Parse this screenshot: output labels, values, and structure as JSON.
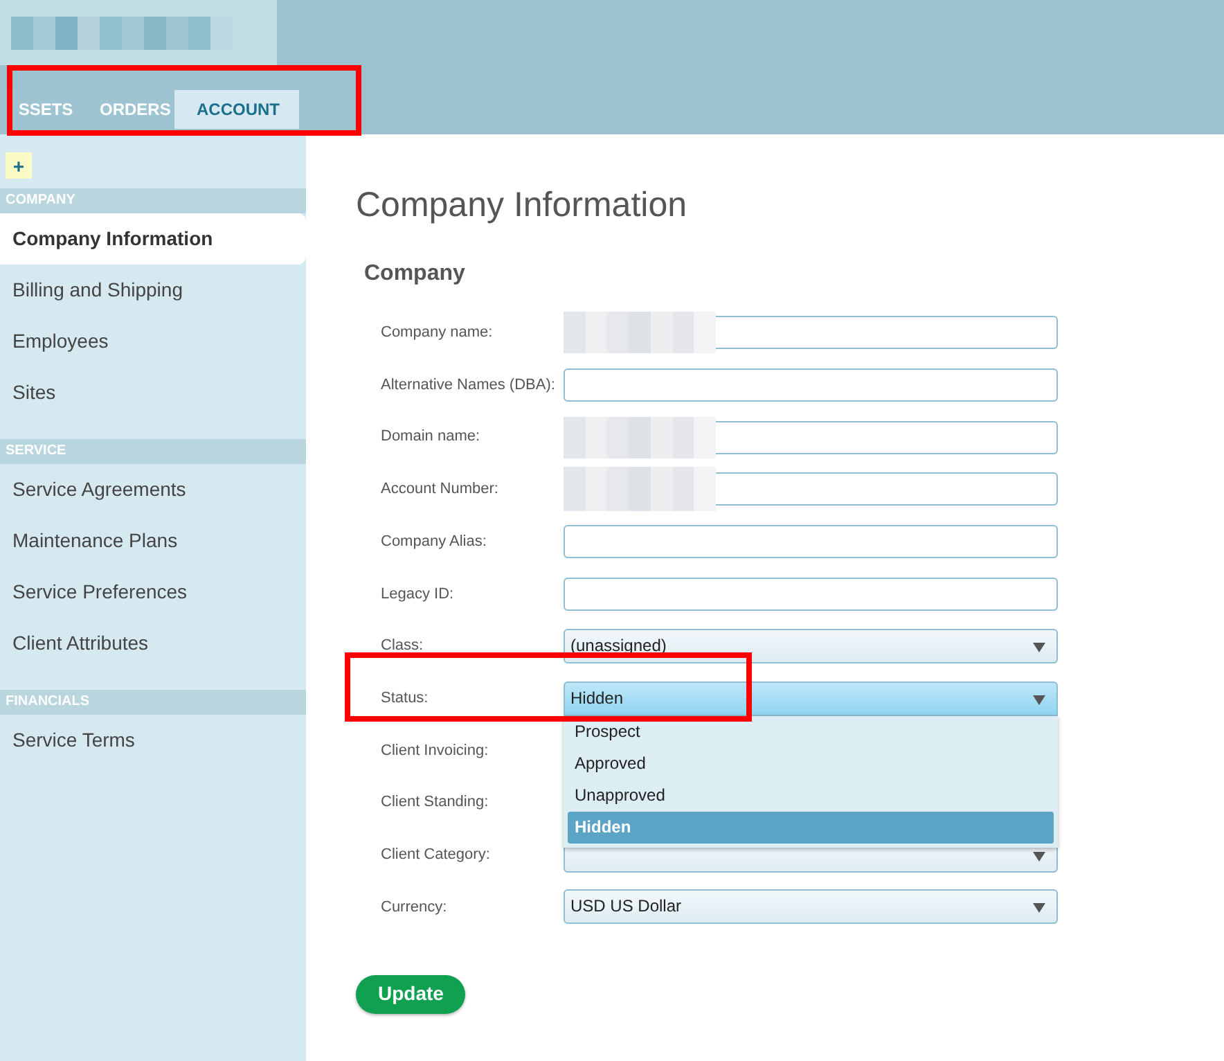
{
  "tabs": [
    {
      "label": "SSETS",
      "selected": false
    },
    {
      "label": "ORDERS",
      "selected": false
    },
    {
      "label": "ACCOUNT",
      "selected": true
    }
  ],
  "sidebar": {
    "add_button": "+",
    "sections": [
      {
        "title": "COMPANY",
        "items": [
          {
            "label": "Company Information",
            "selected": true
          },
          {
            "label": "Billing and Shipping",
            "selected": false
          },
          {
            "label": "Employees",
            "selected": false
          },
          {
            "label": "Sites",
            "selected": false
          }
        ]
      },
      {
        "title": "SERVICE",
        "items": [
          {
            "label": "Service Agreements",
            "selected": false
          },
          {
            "label": "Maintenance Plans",
            "selected": false
          },
          {
            "label": "Service Preferences",
            "selected": false
          },
          {
            "label": "Client Attributes",
            "selected": false
          }
        ]
      },
      {
        "title": "FINANCIALS",
        "items": [
          {
            "label": "Service Terms",
            "selected": false
          }
        ]
      }
    ]
  },
  "page_title": "Company Information",
  "section_title": "Company",
  "fields": [
    {
      "label": "Company name:",
      "kind": "text",
      "redacted": true
    },
    {
      "label": "Alternative Names (DBA):",
      "kind": "text"
    },
    {
      "label": "Domain name:",
      "kind": "text",
      "redacted": true
    },
    {
      "label": "Account Number:",
      "kind": "text",
      "redacted": true
    },
    {
      "label": "Company Alias:",
      "kind": "text"
    },
    {
      "label": "Legacy ID:",
      "kind": "text"
    },
    {
      "label": "Class:",
      "kind": "select",
      "value": "(unassigned)"
    },
    {
      "label": "Status:",
      "kind": "select",
      "value": "Hidden",
      "open": true,
      "options": [
        {
          "label": "Prospect",
          "selected": false
        },
        {
          "label": "Approved",
          "selected": false
        },
        {
          "label": "Unapproved",
          "selected": false
        },
        {
          "label": "Hidden",
          "selected": true
        }
      ]
    },
    {
      "label": "Client Invoicing:"
    },
    {
      "label": "Client Standing:"
    },
    {
      "label": "Client Category:",
      "kind": "select"
    },
    {
      "label": "Currency:",
      "kind": "select",
      "value": "USD US Dollar"
    }
  ],
  "update_button": "Update"
}
